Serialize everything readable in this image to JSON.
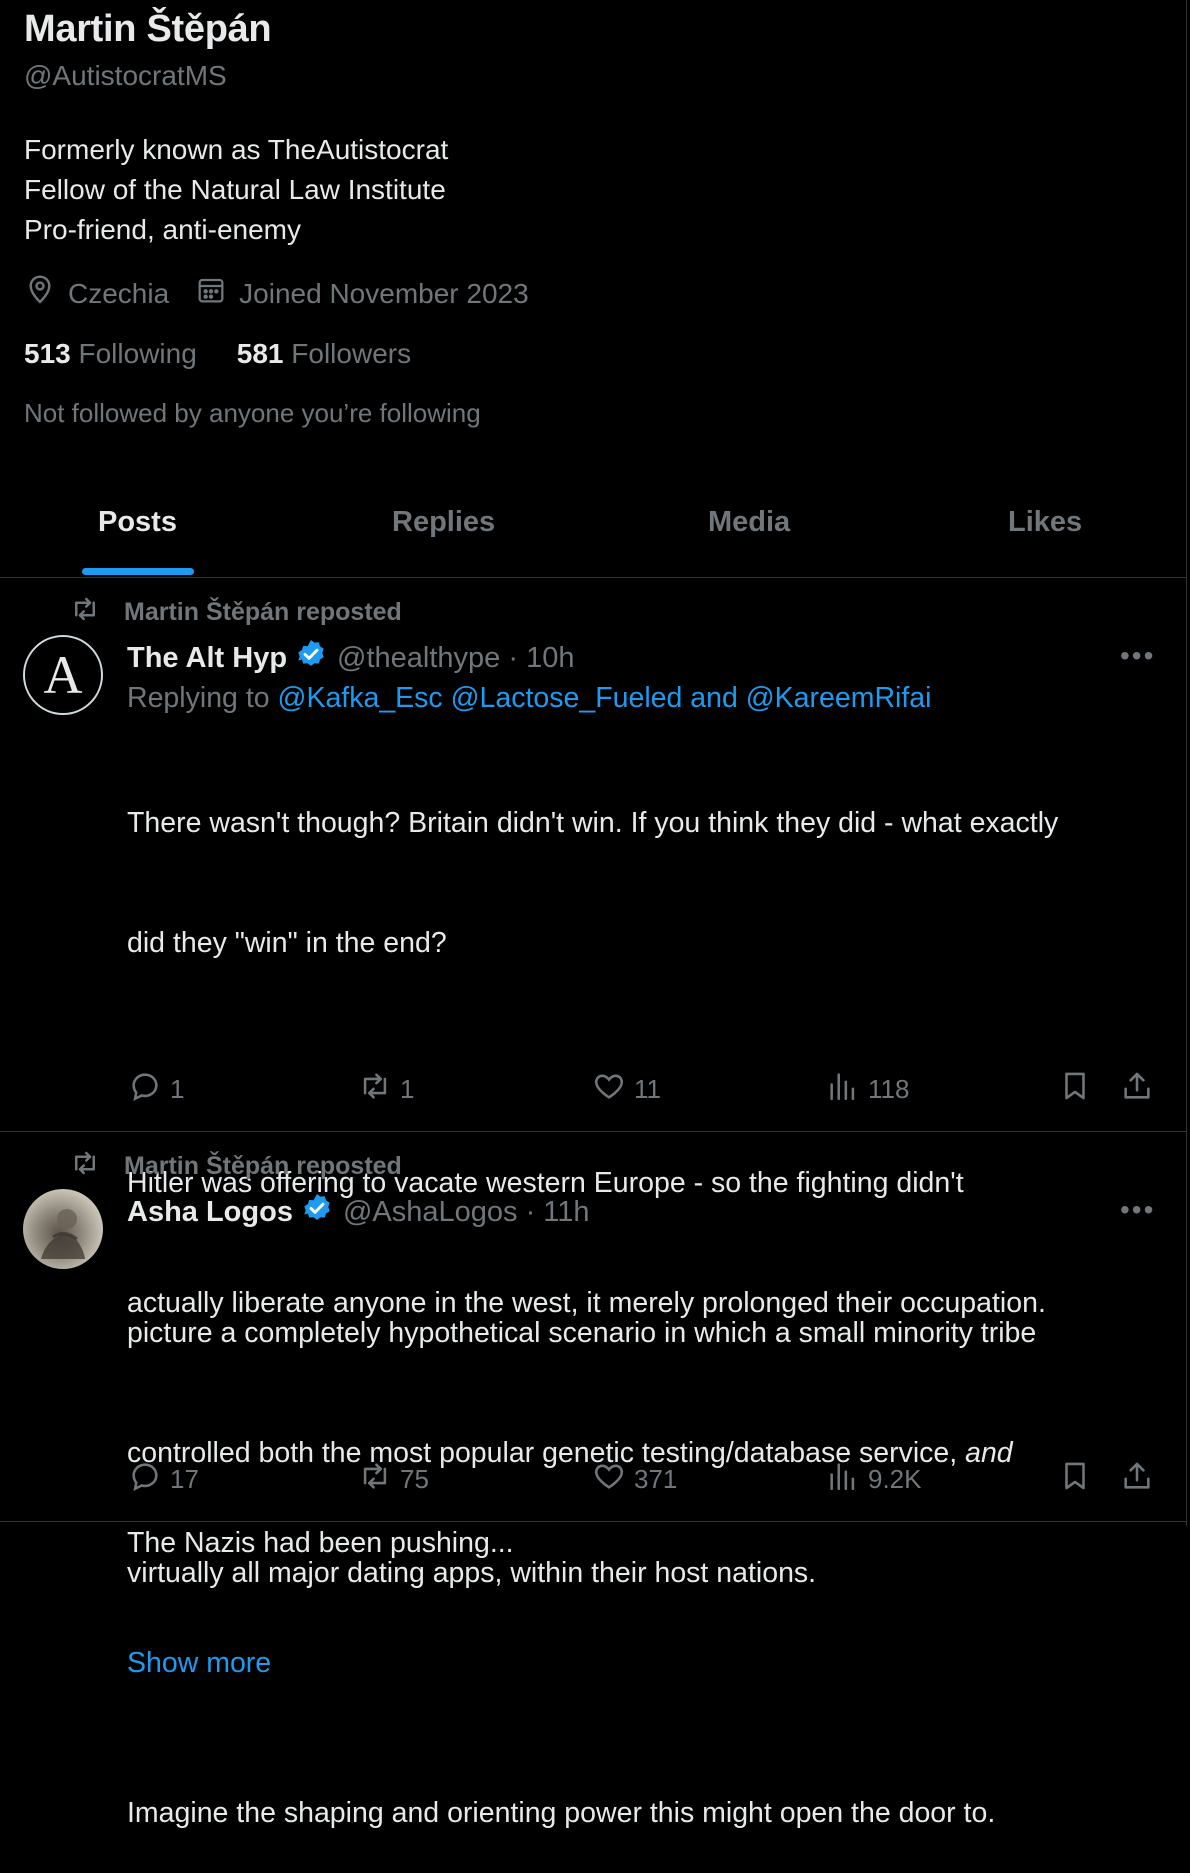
{
  "profile": {
    "name": "Martin Štěpán",
    "handle": "@AutistocratMS",
    "bio": [
      "Formerly known as TheAutistocrat",
      "Fellow of the Natural Law Institute",
      "Pro-friend, anti-enemy"
    ],
    "location": "Czechia",
    "joined": "Joined November 2023",
    "following_count": "513",
    "following_label": "Following",
    "followers_count": "581",
    "followers_label": "Followers",
    "not_followed": "Not followed by anyone you’re following"
  },
  "tabs": [
    {
      "label": "Posts",
      "active": true
    },
    {
      "label": "Replies",
      "active": false
    },
    {
      "label": "Media",
      "active": false
    },
    {
      "label": "Likes",
      "active": false
    }
  ],
  "posts": [
    {
      "reposted_by": "Martin Štěpán reposted",
      "author_name": "The Alt Hyp",
      "author_handle": "@thealthype · 10h",
      "replying_prefix": "Replying to",
      "replying_to": "@Kafka_Esc @Lactose_Fueled and @KareemRifai",
      "text_lines": [
        "There wasn't though? Britain didn't win. If you think they did - what exactly",
        "did they \"win\" in the end?",
        "",
        "Hitler was offering to vacate western Europe - so the fighting didn't",
        "actually liberate anyone in the west, it merely prolonged their occupation.",
        "",
        "The Nazis had been pushing..."
      ],
      "show_more": "Show more",
      "avatar_letter": "A",
      "replies": "1",
      "reposts": "1",
      "likes": "11",
      "views": "118"
    },
    {
      "reposted_by": "Martin Štěpán reposted",
      "author_name": "Asha Logos",
      "author_handle": "@AshaLogos · 11h",
      "text_line1": "picture a completely hypothetical scenario in which a small minority tribe",
      "text_line2_a": "controlled both the most popular genetic testing/database service, ",
      "text_line2_b": "and",
      "text_line3": "virtually all major dating apps, within their host nations.",
      "text_line5": "Imagine the shaping and orienting power this might open the door to.",
      "replies": "17",
      "reposts": "75",
      "likes": "371",
      "views": "9.2K"
    }
  ],
  "colors": {
    "accent": "#1d9bf0",
    "muted": "#71767b",
    "text": "#e7e9ea",
    "divider": "#2f3336"
  },
  "icons": [
    "location-icon",
    "calendar-icon",
    "repost-icon",
    "verified-badge-icon",
    "more-icon",
    "reply-icon",
    "like-icon",
    "views-icon",
    "bookmark-icon",
    "share-icon"
  ]
}
